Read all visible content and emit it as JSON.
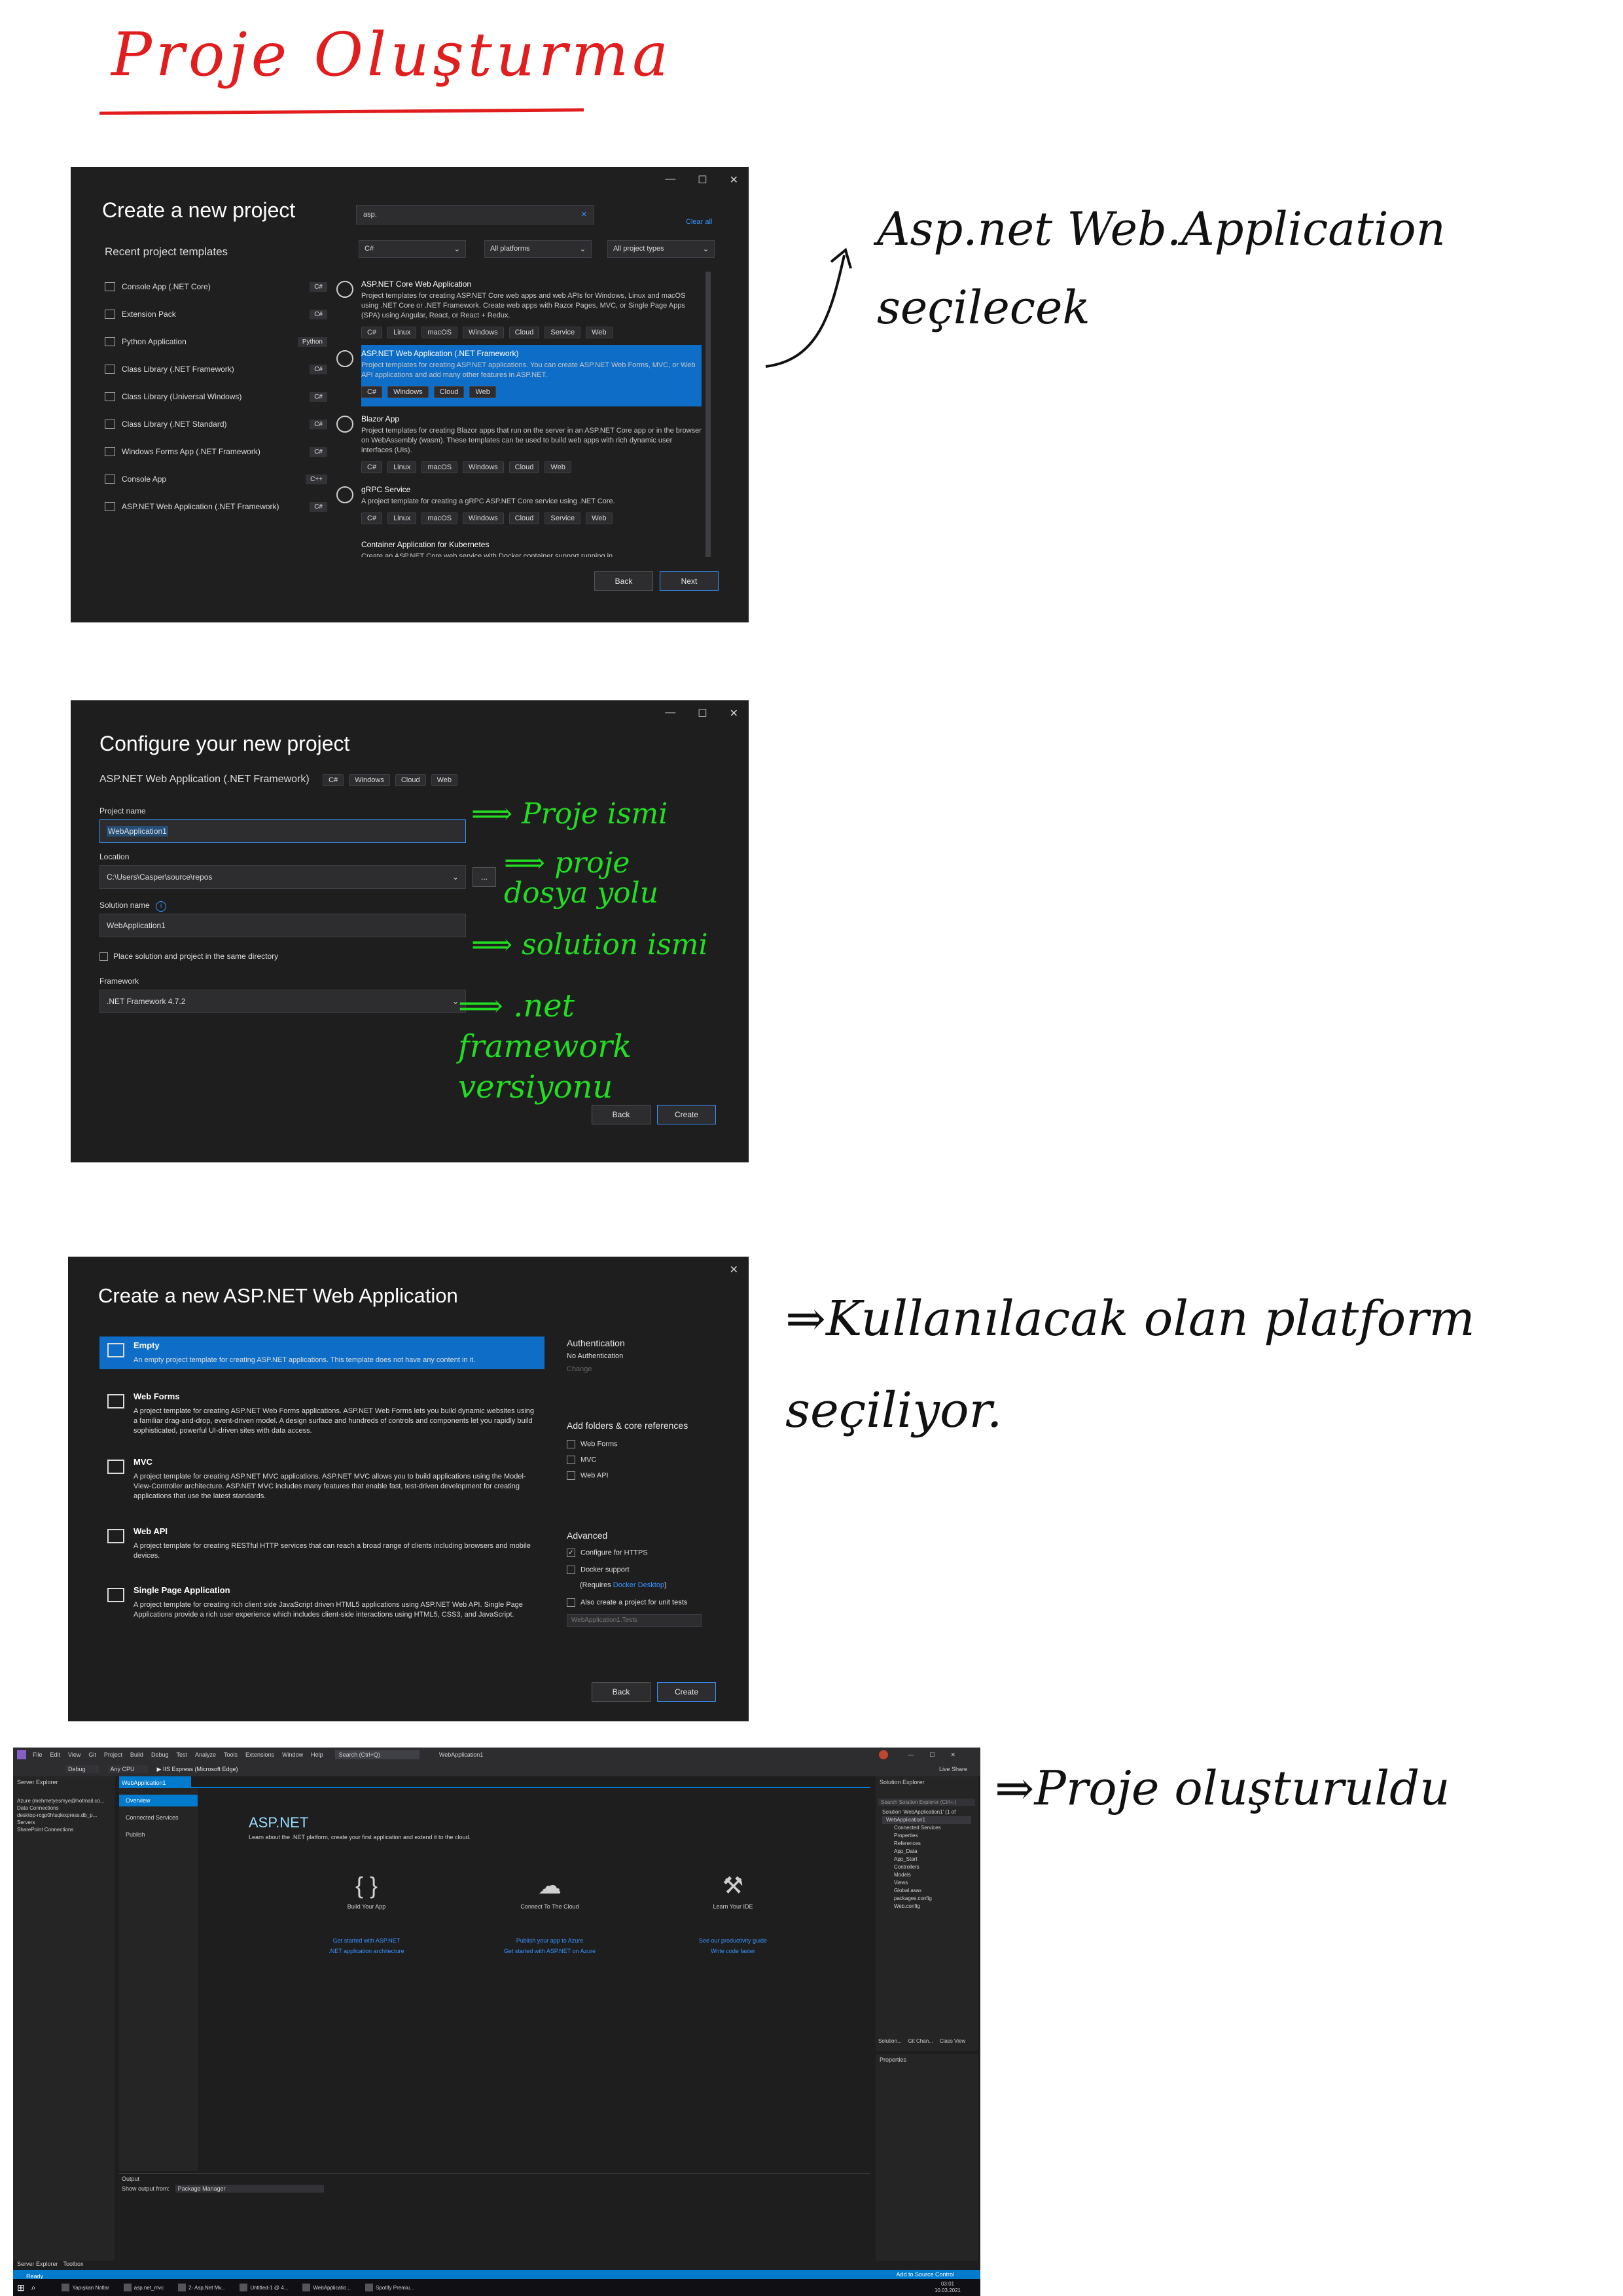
{
  "page": {
    "heading": "Proje Oluşturma",
    "note1": "Asp.net Web.Application seçilecek",
    "note3": "⇒Kullanılacak olan platform seçiliyor.",
    "note4": "⇒Proje oluşturuldu"
  },
  "create_project": {
    "title": "Create a new project",
    "recent_heading": "Recent project templates",
    "search_value": "asp.",
    "clear_all": "Clear all",
    "filter_language": "C#",
    "filter_platform": "All platforms",
    "filter_type": "All project types",
    "recent": [
      {
        "name": "Console App (.NET Core)",
        "lang": "C#"
      },
      {
        "name": "Extension Pack",
        "lang": "C#"
      },
      {
        "name": "Python Application",
        "lang": "Python"
      },
      {
        "name": "Class Library (.NET Framework)",
        "lang": "C#"
      },
      {
        "name": "Class Library (Universal Windows)",
        "lang": "C#"
      },
      {
        "name": "Class Library (.NET Standard)",
        "lang": "C#"
      },
      {
        "name": "Windows Forms App (.NET Framework)",
        "lang": "C#"
      },
      {
        "name": "Console App",
        "lang": "C++"
      },
      {
        "name": "ASP.NET Web Application (.NET Framework)",
        "lang": "C#"
      }
    ],
    "templates": [
      {
        "name": "ASP.NET Core Web Application",
        "desc": "Project templates for creating ASP.NET Core web apps and web APIs for Windows, Linux and macOS using .NET Core or .NET Framework. Create web apps with Razor Pages, MVC, or Single Page Apps (SPA) using Angular, React, or React + Redux.",
        "tags": [
          "C#",
          "Linux",
          "macOS",
          "Windows",
          "Cloud",
          "Service",
          "Web"
        ]
      },
      {
        "name": "ASP.NET Web Application (.NET Framework)",
        "desc": "Project templates for creating ASP.NET applications. You can create ASP.NET Web Forms, MVC, or Web API applications and add many other features in ASP.NET.",
        "tags": [
          "C#",
          "Windows",
          "Cloud",
          "Web"
        ]
      },
      {
        "name": "Blazor App",
        "desc": "Project templates for creating Blazor apps that run on the server in an ASP.NET Core app or in the browser on WebAssembly (wasm). These templates can be used to build web apps with rich dynamic user interfaces (UIs).",
        "tags": [
          "C#",
          "Linux",
          "macOS",
          "Windows",
          "Cloud",
          "Web"
        ]
      },
      {
        "name": "gRPC Service",
        "desc": "A project template for creating a gRPC ASP.NET Core service using .NET Core.",
        "tags": [
          "C#",
          "Linux",
          "macOS",
          "Windows",
          "Cloud",
          "Service",
          "Web"
        ]
      },
      {
        "name": "Container Application for Kubernetes",
        "desc": "Create an ASP.NET Core web service with Docker container support running in",
        "tags": []
      }
    ],
    "back": "Back",
    "next": "Next"
  },
  "configure": {
    "title": "Configure your new project",
    "subtitle": "ASP.NET Web Application (.NET Framework)",
    "tags": [
      "C#",
      "Windows",
      "Cloud",
      "Web"
    ],
    "project_name_label": "Project name",
    "project_name": "WebApplication1",
    "location_label": "Location",
    "location": "C:\\Users\\Casper\\source\\repos",
    "browse": "...",
    "solution_label": "Solution name",
    "solution": "WebApplication1",
    "same_dir": "Place solution and project in the same directory",
    "framework_label": "Framework",
    "framework": ".NET Framework 4.7.2",
    "back": "Back",
    "create": "Create",
    "ann_name": "Proje ismi",
    "ann_location": "proje dosya yolu",
    "ann_solution": "solution ismi",
    "ann_framework": ".net framework versiyonu"
  },
  "aspnet": {
    "title": "Create a new ASP.NET Web Application",
    "items": [
      {
        "name": "Empty",
        "desc": "An empty project template for creating ASP.NET applications. This template does not have any content in it."
      },
      {
        "name": "Web Forms",
        "desc": "A project template for creating ASP.NET Web Forms applications. ASP.NET Web Forms lets you build dynamic websites using a familiar drag-and-drop, event-driven model. A design surface and hundreds of controls and components let you rapidly build sophisticated, powerful UI-driven sites with data access."
      },
      {
        "name": "MVC",
        "desc": "A project template for creating ASP.NET MVC applications. ASP.NET MVC allows you to build applications using the Model-View-Controller architecture. ASP.NET MVC includes many features that enable fast, test-driven development for creating applications that use the latest standards."
      },
      {
        "name": "Web API",
        "desc": "A project template for creating RESTful HTTP services that can reach a broad range of clients including browsers and mobile devices."
      },
      {
        "name": "Single Page Application",
        "desc": "A project template for creating rich client side JavaScript driven HTML5 applications using ASP.NET Web API. Single Page Applications provide a rich user experience which includes client-side interactions using HTML5, CSS3, and JavaScript."
      }
    ],
    "auth_heading": "Authentication",
    "auth_value": "No Authentication",
    "auth_change": "Change",
    "refs_heading": "Add folders & core references",
    "refs": [
      "Web Forms",
      "MVC",
      "Web API"
    ],
    "adv_heading": "Advanced",
    "https": "Configure for HTTPS",
    "docker": "Docker support",
    "docker_req_pre": "(Requires ",
    "docker_req_link": "Docker Desktop",
    "docker_req_post": ")",
    "unit_tests": "Also create a project for unit tests",
    "tests_name": "WebApplication1.Tests",
    "back": "Back",
    "create": "Create"
  },
  "ide": {
    "menu": [
      "File",
      "Edit",
      "View",
      "Git",
      "Project",
      "Build",
      "Debug",
      "Test",
      "Analyze",
      "Tools",
      "Extensions",
      "Window",
      "Help"
    ],
    "search": "Search (Ctrl+Q)",
    "solution_tab": "WebApplication1",
    "config": "Debug",
    "cpu": "Any CPU",
    "run": "IIS Express (Microsoft Edge)",
    "live_share": "Live Share",
    "server_explorer": "Server Explorer",
    "server_items": [
      "Azure (mehmetyesmye@hotmail.co...",
      "Data Connections",
      "desktop-rcgp0h\\sqlexpress.db_p...",
      "Servers",
      "SharePoint Connections"
    ],
    "doc_tab": "WebApplication1",
    "side_nav": [
      "Overview",
      "Connected Services",
      "Publish"
    ],
    "asp_title": "ASP.NET",
    "asp_sub": "Learn about the .NET platform, create your first application and extend it to the cloud.",
    "cards": [
      {
        "title": "Build Your App",
        "links": [
          "Get started with ASP.NET",
          ".NET application architecture"
        ]
      },
      {
        "title": "Connect To The Cloud",
        "links": [
          "Publish your app to Azure",
          "Get started with ASP.NET on Azure"
        ]
      },
      {
        "title": "Learn Your IDE",
        "links": [
          "See our productivity guide",
          "Write code faster"
        ]
      }
    ],
    "output_title": "Output",
    "output_from_label": "Show output from:",
    "output_from": "Package Manager",
    "sol_explorer": "Solution Explorer",
    "sol_search": "Search Solution Explorer (Ctrl+;)",
    "sol_items": [
      "Solution 'WebApplication1' (1 of",
      "WebApplication1",
      "Connected Services",
      "Properties",
      "References",
      "App_Data",
      "App_Start",
      "Controllers",
      "Models",
      "Views",
      "Global.asax",
      "packages.config",
      "Web.config"
    ],
    "sol_tabs": [
      "Solution...",
      "Git Chan...",
      "Class View"
    ],
    "properties": "Properties",
    "bottom_tabs": [
      "Server Explorer",
      "Toolbox"
    ],
    "status": "Ready",
    "source_control": "Add to Source Control",
    "taskbar_items": [
      "Yapışkan Notlar",
      "asp.net_mvc",
      "2- Asp.Net Mv...",
      "Untitled-1 @ 4...",
      "WebApplicatio...",
      "Spotify Premiu..."
    ],
    "clock_time": "03:01",
    "clock_date": "10.03.2021"
  },
  "colors": {
    "accent": "#007acc",
    "annotation_red": "#e11d1d",
    "annotation_green": "#22dd22"
  }
}
